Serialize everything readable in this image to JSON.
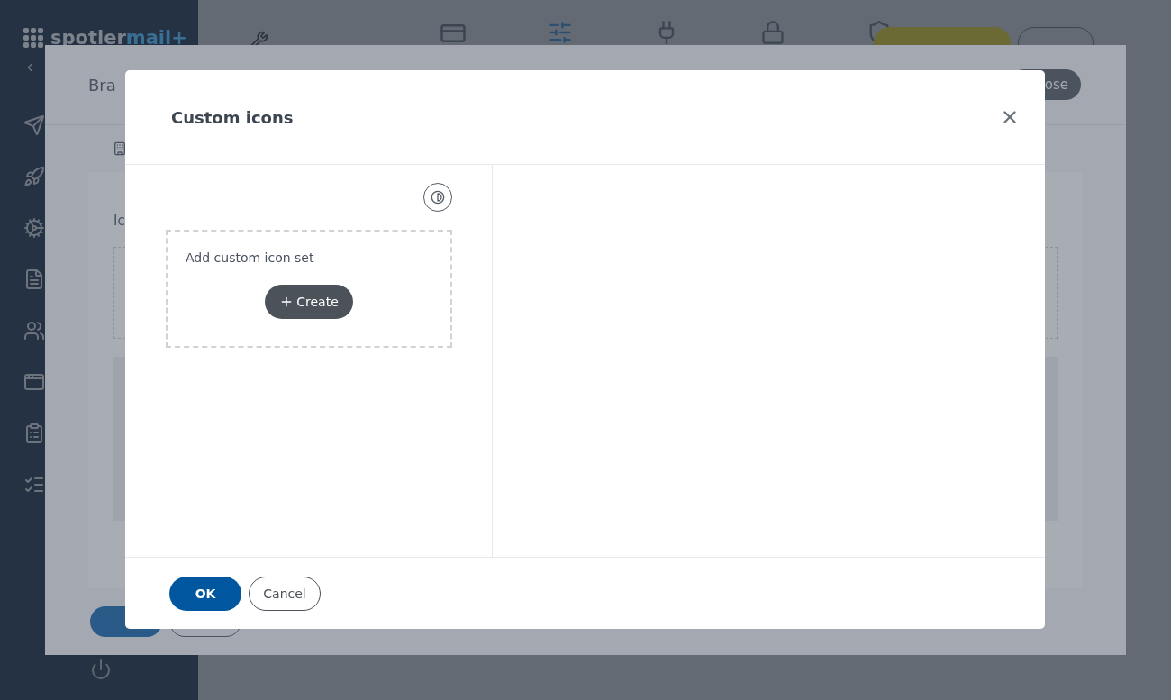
{
  "app": {
    "logo": {
      "brand": "spotler",
      "suffix": "mail+"
    }
  },
  "behind_modal": {
    "title": "Bra",
    "close_button": "ose",
    "section_label": "Ic"
  },
  "dialog": {
    "title": "Custom icons",
    "panel": {
      "prompt": "Add custom icon set",
      "create_button": "Create"
    },
    "buttons": [
      {
        "label": "OK",
        "kind": "primary"
      },
      {
        "label": "Cancel",
        "kind": "secondary"
      }
    ]
  }
}
